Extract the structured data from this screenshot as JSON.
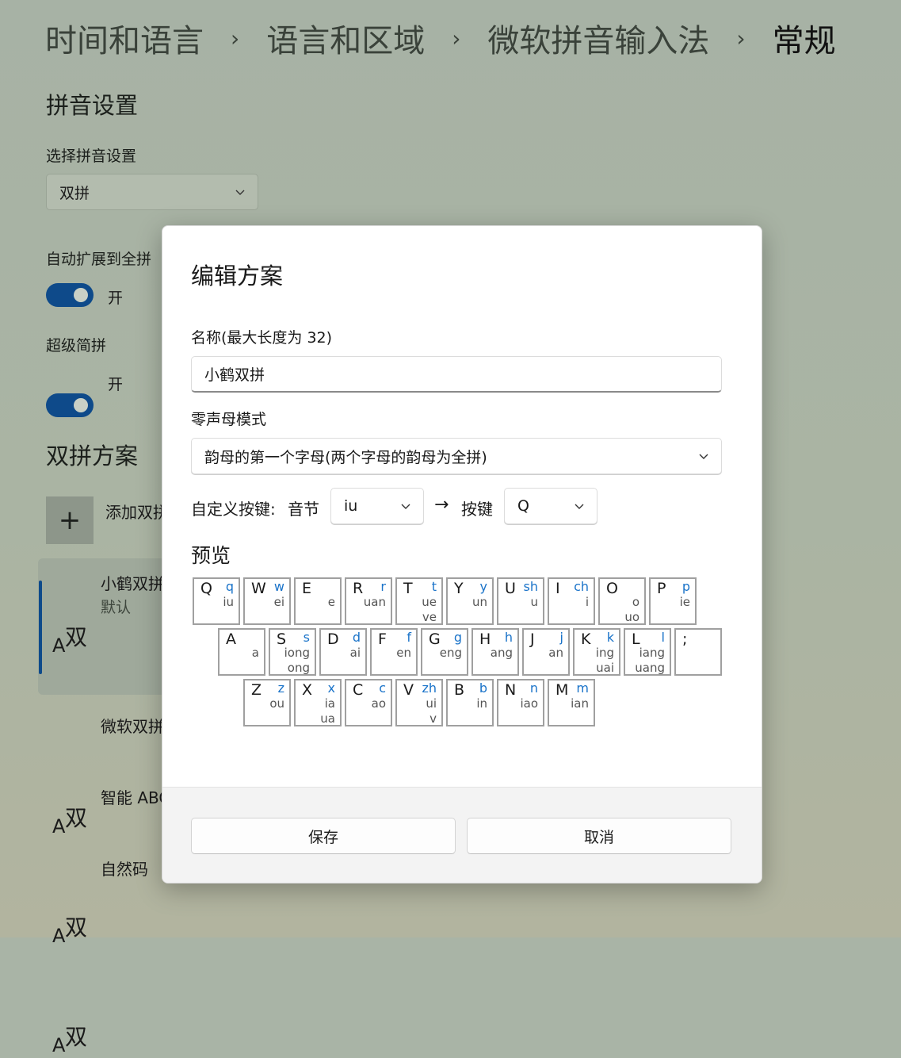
{
  "breadcrumb": [
    "时间和语言",
    "语言和区域",
    "微软拼音输入法",
    "常规"
  ],
  "pinyin_settings": {
    "title": "拼音设置",
    "select_label": "选择拼音设置",
    "select_value": "双拼",
    "auto_expand_label": "自动扩展到全拼",
    "auto_expand_state": "开",
    "super_abbrev_label": "超级简拼",
    "super_abbrev_state": "开"
  },
  "shuangpin": {
    "title": "双拼方案",
    "add_label": "添加双拼方案",
    "schemes": [
      {
        "name": "小鹤双拼",
        "sub": "默认"
      },
      {
        "name": "微软双拼"
      },
      {
        "name": "智能 ABC"
      },
      {
        "name": "自然码"
      }
    ]
  },
  "icon_glyphs": {
    "top": "双",
    "bottom": "A"
  },
  "dialog": {
    "title": "编辑方案",
    "name_label": "名称(最大长度为 32)",
    "name_value": "小鹤双拼",
    "zero_initial_label": "零声母模式",
    "zero_initial_value": "韵母的第一个字母(两个字母的韵母为全拼)",
    "custom_key_label": "自定义按键:",
    "syllable_label": "音节",
    "syllable_value": "iu",
    "arrow": "→",
    "key_label": "按键",
    "key_value": "Q",
    "preview_title": "预览",
    "save_label": "保存",
    "cancel_label": "取消"
  },
  "keyboard": {
    "rows": [
      [
        {
          "k": "Q",
          "s": "q",
          "v": [
            "iu"
          ]
        },
        {
          "k": "W",
          "s": "w",
          "v": [
            "ei"
          ]
        },
        {
          "k": "E",
          "s": "",
          "v": [
            "e"
          ]
        },
        {
          "k": "R",
          "s": "r",
          "v": [
            "uan"
          ]
        },
        {
          "k": "T",
          "s": "t",
          "v": [
            "ue",
            "ve"
          ]
        },
        {
          "k": "Y",
          "s": "y",
          "v": [
            "un"
          ]
        },
        {
          "k": "U",
          "s": "sh",
          "v": [
            "u"
          ]
        },
        {
          "k": "I",
          "s": "ch",
          "v": [
            "i"
          ]
        },
        {
          "k": "O",
          "s": "",
          "v": [
            "o",
            "uo"
          ]
        },
        {
          "k": "P",
          "s": "p",
          "v": [
            "ie"
          ]
        }
      ],
      [
        {
          "k": "A",
          "s": "",
          "v": [
            "a"
          ]
        },
        {
          "k": "S",
          "s": "s",
          "v": [
            "iong",
            "ong"
          ]
        },
        {
          "k": "D",
          "s": "d",
          "v": [
            "ai"
          ]
        },
        {
          "k": "F",
          "s": "f",
          "v": [
            "en"
          ]
        },
        {
          "k": "G",
          "s": "g",
          "v": [
            "eng"
          ]
        },
        {
          "k": "H",
          "s": "h",
          "v": [
            "ang"
          ]
        },
        {
          "k": "J",
          "s": "j",
          "v": [
            "an"
          ]
        },
        {
          "k": "K",
          "s": "k",
          "v": [
            "ing",
            "uai"
          ]
        },
        {
          "k": "L",
          "s": "l",
          "v": [
            "iang",
            "uang"
          ]
        },
        {
          "k": ";",
          "s": "",
          "v": []
        }
      ],
      [
        {
          "k": "Z",
          "s": "z",
          "v": [
            "ou"
          ]
        },
        {
          "k": "X",
          "s": "x",
          "v": [
            "ia",
            "ua"
          ]
        },
        {
          "k": "C",
          "s": "c",
          "v": [
            "ao"
          ]
        },
        {
          "k": "V",
          "s": "zh",
          "v": [
            "ui",
            "v"
          ]
        },
        {
          "k": "B",
          "s": "b",
          "v": [
            "in"
          ]
        },
        {
          "k": "N",
          "s": "n",
          "v": [
            "iao"
          ]
        },
        {
          "k": "M",
          "s": "m",
          "v": [
            "ian"
          ]
        }
      ]
    ]
  },
  "colors": {
    "accent": "#0e4a8a",
    "shengmu": "#1a73c9"
  }
}
